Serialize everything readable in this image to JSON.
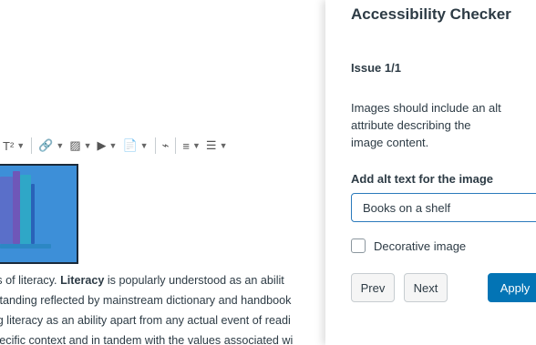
{
  "toolbar": {
    "superscript_label": "T²",
    "items": [
      {
        "icon": "link-icon",
        "glyph": "🔗"
      },
      {
        "icon": "image-icon",
        "glyph": "▨"
      },
      {
        "icon": "media-icon",
        "glyph": "▶"
      },
      {
        "icon": "document-icon",
        "glyph": "📄"
      },
      {
        "icon": "embed-icon",
        "glyph": "⌁"
      },
      {
        "icon": "align-icon",
        "glyph": "≡"
      },
      {
        "icon": "list-icon",
        "glyph": "☰"
      }
    ]
  },
  "editor": {
    "paragraph": {
      "line1_pre": "tions of literacy. ",
      "line1_bold": "Literacy",
      "line1_post": " is popularly understood as an abilit",
      "line2": "erstanding reflected by mainstream dictionary and handbook",
      "line3": "ning literacy as an ability apart from any actual event of readi",
      "line4": "specific context and in tandem with the values associated wi"
    }
  },
  "tray": {
    "title": "Accessibility Checker",
    "issue_count": "Issue 1/1",
    "help_icon_glyph": "?",
    "description": "Images should include an alt attribute describing the image content.",
    "alt_label": "Add alt text for the image",
    "alt_value": "Books on a shelf",
    "decorative_label": "Decorative image",
    "prev_label": "Prev",
    "next_label": "Next",
    "apply_label": "Apply",
    "colors": {
      "apply": "#0374b5",
      "input_border": "#2b7abc"
    }
  }
}
